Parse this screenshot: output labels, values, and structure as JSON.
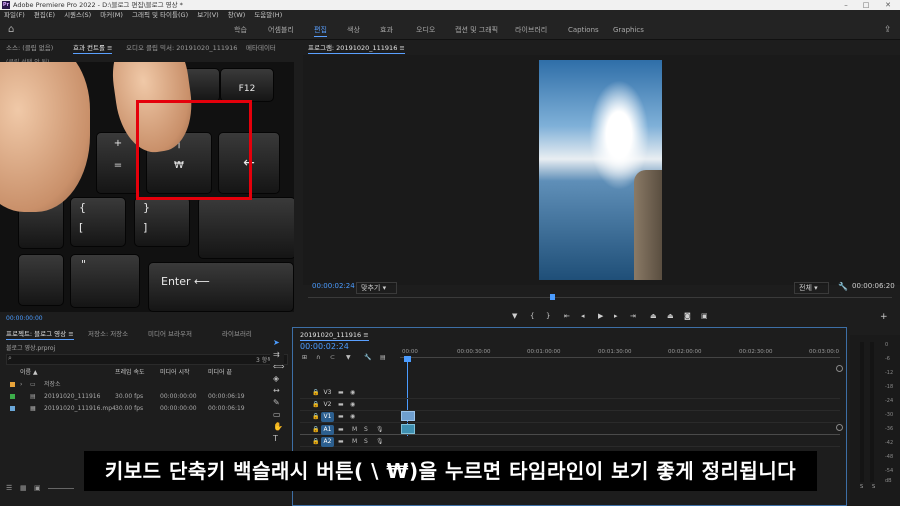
{
  "app": {
    "logo_text": "Pr",
    "window_title": "Adobe Premiere Pro 2022 - D:\\블로그 편집\\블로그 영상 *"
  },
  "menu": [
    "파일(F)",
    "편집(E)",
    "시퀀스(S)",
    "마커(M)",
    "그래픽 및 타이틀(G)",
    "보기(V)",
    "창(W)",
    "도움말(H)"
  ],
  "workspaces": [
    "학습",
    "어셈블리",
    "편집",
    "색상",
    "효과",
    "오디오",
    "캡션 및 그래픽",
    "라이브러리",
    "Captions",
    "Graphics"
  ],
  "active_workspace": "편집",
  "source_panel": {
    "tabs": [
      "소스: (클립 없음)",
      "효과 컨트롤 ≡",
      "오디오 클립 믹서: 20191020_111916",
      "메타데이터"
    ],
    "no_clip_label": "(클립 선택 안 됨)",
    "timecode": "00:00:00:00",
    "keys": {
      "f12": "F12",
      "plus": "+",
      "eq": "=",
      "pipe": "|",
      "won": "₩",
      "back": "←",
      "brace_open": "{",
      "bracket_open": "[",
      "brace_close": "}",
      "bracket_close": "]",
      "quote": "\"",
      "enter": "Enter ⟵"
    }
  },
  "program_monitor": {
    "title": "프로그램: 20191020_111916 ≡",
    "timecode_current": "00:00:02:24",
    "fit_label": "맞추기",
    "quality_label": "전체",
    "timecode_duration": "00:00:06:20"
  },
  "project_panel": {
    "tabs": [
      "프로젝트: 블로그 영상 ≡",
      "저장소: 저장소",
      "미디어 브라우저",
      "라이브러리"
    ],
    "file_name": "블로그 영상.prproj",
    "item_count": "3 항목",
    "columns": [
      "이름 ▲",
      "프레임 속도",
      "미디어 시작",
      "미디어 끝"
    ],
    "rows": [
      {
        "name": "저장소",
        "fps": "",
        "start": "",
        "end": "",
        "color": "#e8a33a"
      },
      {
        "name": "20191020_111916",
        "fps": "30.00 fps",
        "start": "00:00:00:00",
        "end": "00:00:06:19",
        "color": "#3cae4a"
      },
      {
        "name": "20191020_111916.mp4",
        "fps": "30.00 fps",
        "start": "00:00:00:00",
        "end": "00:00:06:19",
        "color": "#6aa7d8"
      }
    ]
  },
  "timeline": {
    "tab": "20191020_111916 ≡",
    "timecode": "00:00:02:24",
    "ruler": [
      "00:00",
      "00:00:30:00",
      "00:01:00:00",
      "00:01:30:00",
      "00:02:00:00",
      "00:02:30:00",
      "00:03:00:0"
    ],
    "video_tracks": [
      "V3",
      "V2",
      "V1"
    ],
    "audio_tracks": [
      "A1",
      "A2"
    ],
    "track_buttons": {
      "mute": "M",
      "solo": "S"
    }
  },
  "audio_meter": {
    "labels": [
      "0",
      "-6",
      "-12",
      "-18",
      "-24",
      "-30",
      "-36",
      "-42",
      "-48",
      "-54",
      "dB"
    ],
    "channels": [
      "S",
      "S"
    ]
  },
  "subtitle": "키보드 단축키 백슬래시 버튼( \\ ₩)을 누르면 타임라인이 보기 좋게 정리됩니다",
  "colors": {
    "accent": "#4b9cff",
    "highlight_box": "#e5000b",
    "track_selected": "#2c5f8f",
    "clip": "#6f9fcf"
  }
}
